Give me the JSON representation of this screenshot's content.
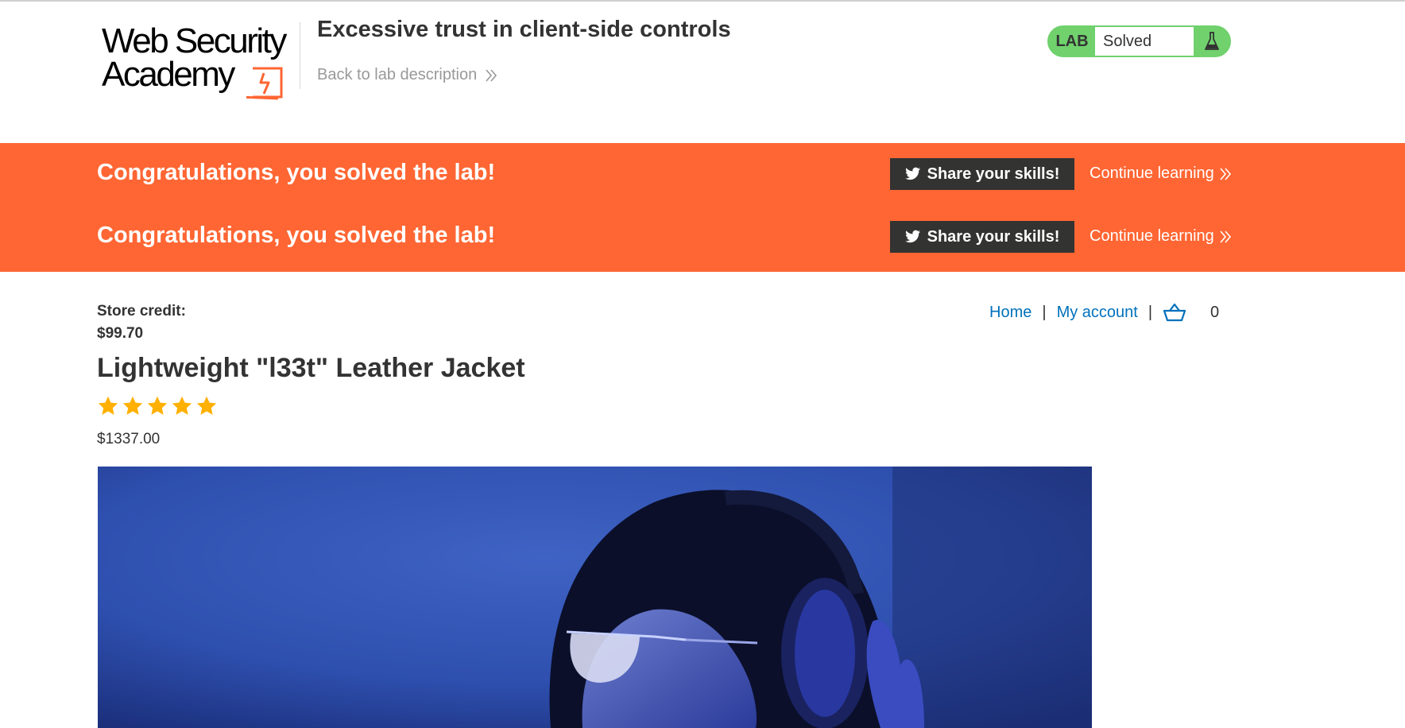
{
  "header": {
    "logo_line1": "Web Security",
    "logo_line2": "Academy",
    "lab_title": "Excessive trust in client-side controls",
    "back_link": "Back to lab description",
    "lab_status": {
      "tag": "LAB",
      "state": "Solved",
      "color": "#70d16d"
    }
  },
  "banner": {
    "rows": [
      {
        "message": "Congratulations, you solved the lab!",
        "share_label": "Share your skills!",
        "continue_label": "Continue learning"
      },
      {
        "message": "Congratulations, you solved the lab!",
        "share_label": "Share your skills!",
        "continue_label": "Continue learning"
      }
    ],
    "color": "#ff6633"
  },
  "store": {
    "credit_label": "Store credit:",
    "credit_value": "$99.70",
    "nav": {
      "home": "Home",
      "separator": "|",
      "account": "My account",
      "cart_count": "0"
    }
  },
  "product": {
    "title": "Lightweight \"l33t\" Leather Jacket",
    "rating": 5,
    "rating_max": 5,
    "price": "$1337.00",
    "image_icon": "product-photo-headphones"
  },
  "colors": {
    "link": "#0071bc",
    "star": "#ffb000",
    "dark_button": "#333332"
  }
}
